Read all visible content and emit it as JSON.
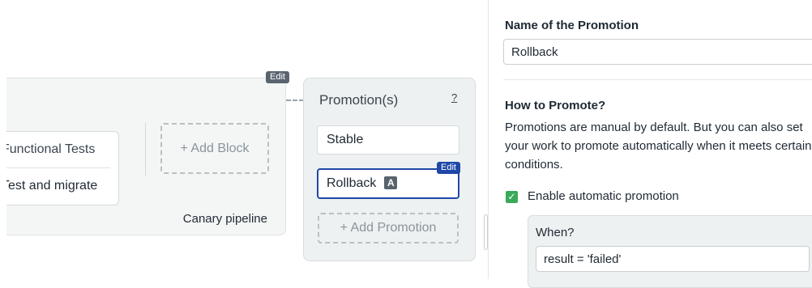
{
  "canvas": {
    "pipeline": {
      "edit_label": "Edit",
      "blocks": [
        {
          "label": "Functional Tests"
        },
        {
          "label": "Test and migrate"
        }
      ],
      "add_block_label": "+ Add Block",
      "name": "Canary pipeline"
    },
    "promotions": {
      "title": "Promotion(s)",
      "help": "?",
      "items": [
        {
          "label": "Stable"
        },
        {
          "label": "Rollback",
          "badge": "A",
          "edit_label": "Edit"
        }
      ],
      "add_label": "+ Add Promotion"
    }
  },
  "panel": {
    "name_label": "Name of the Promotion",
    "name_value": "Rollback",
    "how_label": "How to Promote?",
    "how_description": "Promotions are manual by default. But you can also set your work to promote automatically when it meets certain conditions.",
    "auto_checkbox": {
      "label": "Enable automatic promotion",
      "checked": true,
      "check_glyph": "✓"
    },
    "when": {
      "label": "When?",
      "value": "result = 'failed'"
    }
  },
  "colors": {
    "accent": "#1e47a8",
    "check": "#3aaa5a",
    "edit_tag": "#5a6470"
  }
}
